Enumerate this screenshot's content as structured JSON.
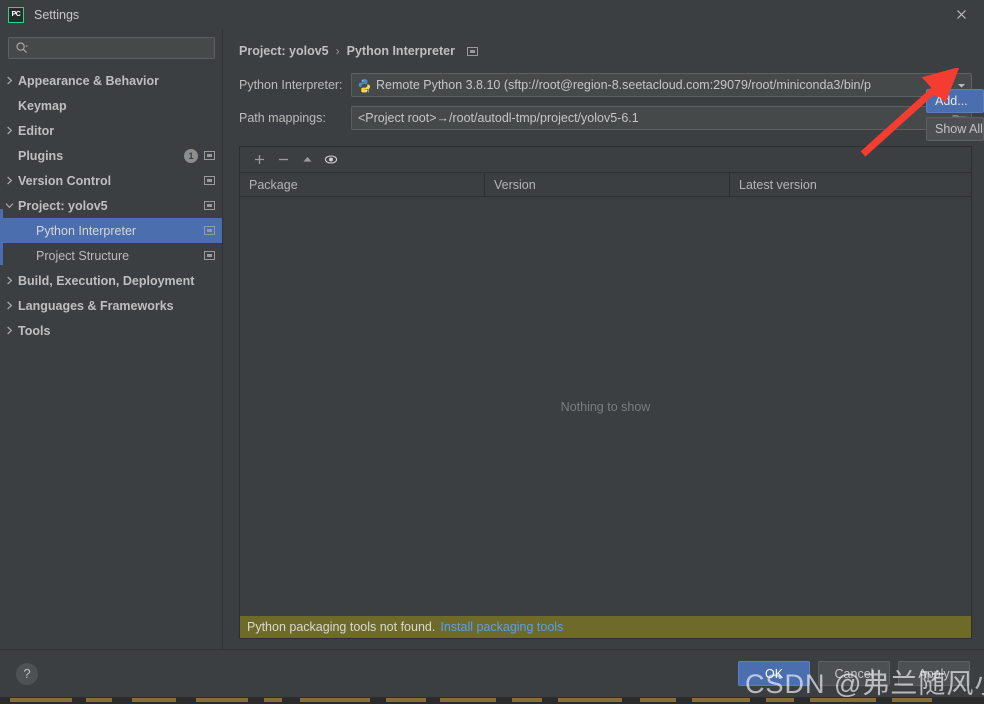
{
  "window": {
    "title": "Settings",
    "logo_text": "PC",
    "close_icon": "close-icon"
  },
  "sidebar": {
    "search": {
      "value": "",
      "placeholder": "",
      "icon": "search-icon"
    },
    "items": [
      {
        "label": "Appearance & Behavior",
        "twisty": "right",
        "bold": true,
        "indent": 0,
        "badge": "",
        "scope_icon": false,
        "selected": false
      },
      {
        "label": "Keymap",
        "twisty": "none",
        "bold": true,
        "indent": 0,
        "badge": "",
        "scope_icon": false,
        "selected": false
      },
      {
        "label": "Editor",
        "twisty": "right",
        "bold": true,
        "indent": 0,
        "badge": "",
        "scope_icon": false,
        "selected": false
      },
      {
        "label": "Plugins",
        "twisty": "none",
        "bold": true,
        "indent": 0,
        "badge": "1",
        "scope_icon": true,
        "selected": false
      },
      {
        "label": "Version Control",
        "twisty": "right",
        "bold": true,
        "indent": 0,
        "badge": "",
        "scope_icon": true,
        "selected": false
      },
      {
        "label": "Project: yolov5",
        "twisty": "down",
        "bold": true,
        "indent": 0,
        "badge": "",
        "scope_icon": true,
        "selected": false
      },
      {
        "label": "Python Interpreter",
        "twisty": "none",
        "bold": false,
        "indent": 1,
        "badge": "",
        "scope_icon": true,
        "selected": true
      },
      {
        "label": "Project Structure",
        "twisty": "none",
        "bold": false,
        "indent": 1,
        "badge": "",
        "scope_icon": true,
        "selected": false
      },
      {
        "label": "Build, Execution, Deployment",
        "twisty": "right",
        "bold": true,
        "indent": 0,
        "badge": "",
        "scope_icon": false,
        "selected": false
      },
      {
        "label": "Languages & Frameworks",
        "twisty": "right",
        "bold": true,
        "indent": 0,
        "badge": "",
        "scope_icon": false,
        "selected": false
      },
      {
        "label": "Tools",
        "twisty": "right",
        "bold": true,
        "indent": 0,
        "badge": "",
        "scope_icon": false,
        "selected": false
      }
    ]
  },
  "main": {
    "breadcrumb": {
      "project": "Project: yolov5",
      "separator": "›",
      "page": "Python Interpreter",
      "scope_icon": "project-scope-icon"
    },
    "interpreter_row": {
      "label": "Python Interpreter:",
      "value": "Remote Python 3.8.10 (sftp://root@region-8.seetacloud.com:29079/root/miniconda3/bin/p",
      "icon": "python-remote-icon",
      "arrow_icon": "chevron-down-icon"
    },
    "path_mappings_row": {
      "label": "Path mappings:",
      "value": "<Project root>→/root/autodl-tmp/project/yolov5-6.1",
      "browse_icon": "folder-icon"
    },
    "side_buttons": [
      {
        "label": "Add...",
        "primary": true
      },
      {
        "label": "Show All...",
        "primary": false
      }
    ],
    "packages": {
      "toolbar": [
        {
          "name": "add-package-button",
          "icon": "plus-icon"
        },
        {
          "name": "remove-package-button",
          "icon": "minus-icon"
        },
        {
          "name": "upgrade-package-button",
          "icon": "upgrade-arrow-icon"
        },
        {
          "name": "show-early-releases-button",
          "icon": "eye-icon"
        }
      ],
      "columns": [
        "Package",
        "Version",
        "Latest version"
      ],
      "rows": [],
      "empty_text": "Nothing to show",
      "warning": {
        "text": "Python packaging tools not found.",
        "link": "Install packaging tools",
        "background": "#6e6b2a",
        "link_color": "#589df6"
      }
    }
  },
  "footer": {
    "help_label": "?",
    "buttons": [
      {
        "label": "OK",
        "primary": true
      },
      {
        "label": "Cancel",
        "primary": false
      },
      {
        "label": "Apply",
        "primary": false
      }
    ]
  },
  "overlay": {
    "watermark": "CSDN @弗兰随风小欢",
    "arrow_color": "#f43d30"
  },
  "theme": {
    "background": "#3c3f41",
    "selection": "#4b6eaf",
    "field_background": "#45494a",
    "border": "#5e6060",
    "text": "#bbbbbb"
  }
}
